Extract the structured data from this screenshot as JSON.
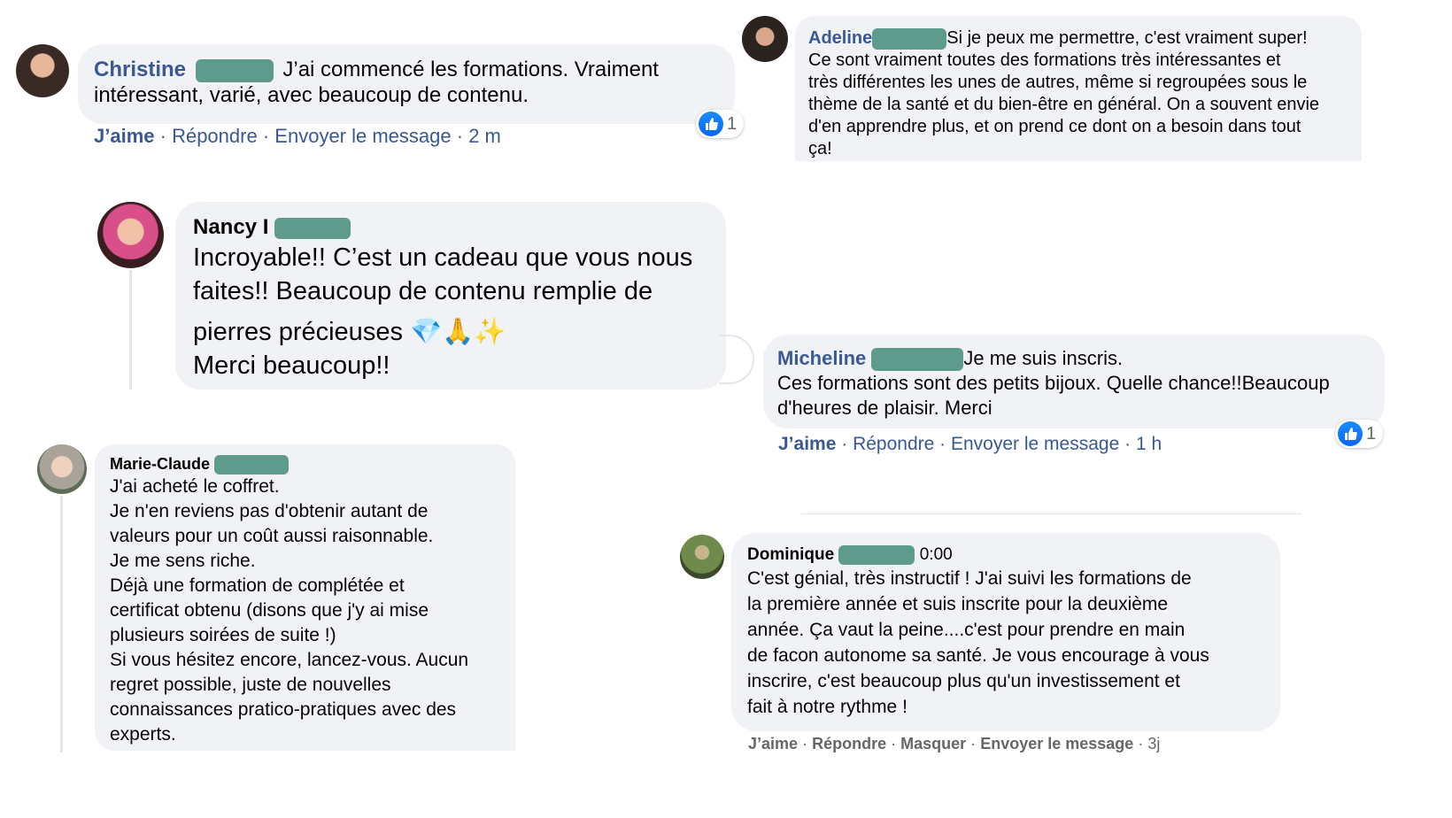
{
  "colors": {
    "link": "#385898",
    "bubble": "#f0f2f5",
    "redaction": "#5f9b8c",
    "like_blue": "#0866ff"
  },
  "comments": {
    "christine": {
      "name": "Christine",
      "text_lines": [
        "J’ai commencé les formations. Vraiment",
        "intéressant, varié, avec beaucoup de contenu."
      ],
      "actions": {
        "like": "J’aime",
        "sep": "·",
        "reply": "Répondre",
        "message": "Envoyer le message",
        "time": "2 m"
      },
      "reaction_count": "1",
      "avatar_icon": "woman-portrait-icon"
    },
    "adeline": {
      "name": "Adeline",
      "text_lines": [
        "Si je peux me permettre, c'est vraiment super!",
        "Ce sont vraiment toutes des formations très intéressantes et",
        "très différentes les unes de autres, même si regroupées sous le",
        "thème de la santé et du bien-être en général. On a souvent envie",
        "d'en apprendre plus, et on prend ce dont on a besoin dans tout",
        "ça!"
      ],
      "avatar_icon": "woman-portrait-icon"
    },
    "nancy": {
      "name": "Nancy I",
      "text_lines": [
        "Incroyable!! C’est un cadeau que vous nous",
        "faites!! Beaucoup de contenu remplie de",
        "pierres précieuses",
        "Merci beaucoup!!"
      ],
      "emojis": [
        "💎",
        "🙏",
        "✨"
      ],
      "avatar_icon": "woman-portrait-icon"
    },
    "micheline": {
      "name": "Micheline",
      "text_lines": [
        "Je me suis inscris.",
        "Ces formations sont des petits bijoux. Quelle chance!!Beaucoup",
        "d'heures de plaisir. Merci"
      ],
      "actions": {
        "like": "J’aime",
        "sep": "·",
        "reply": "Répondre",
        "message": "Envoyer le message",
        "time": "1 h"
      },
      "reaction_count": "1"
    },
    "marie_claude": {
      "name": "Marie-Claude",
      "text_lines": [
        "J'ai acheté le coffret.",
        "Je n'en reviens pas d'obtenir autant de",
        "valeurs pour un coût aussi raisonnable.",
        "Je me sens riche.",
        "Déjà une formation de complétée et",
        "certificat obtenu (disons que j'y ai mise",
        "plusieurs soirées de suite !)",
        "Si vous hésitez encore, lancez-vous.  Aucun",
        "regret possible, juste de nouvelles",
        "connaissances pratico-pratiques avec des",
        "experts."
      ],
      "avatar_icon": "woman-portrait-icon"
    },
    "dominique": {
      "name": "Dominique",
      "timestamp": "0:00",
      "text_lines": [
        "C'est génial, très instructif ! J'ai suivi les formations de",
        "la première année et suis inscrite pour la deuxième",
        "année. Ça vaut la peine....c'est pour prendre en main",
        "de facon autonome sa santé. Je vous encourage à vous",
        "inscrire, c'est beaucoup plus qu'un investissement et",
        "fait à notre rythme !"
      ],
      "actions": {
        "like": "J’aime",
        "sep": "·",
        "reply": "Répondre",
        "hide": "Masquer",
        "message": "Envoyer le message",
        "time": "3j"
      },
      "avatar_icon": "cyclist-portrait-icon"
    }
  }
}
